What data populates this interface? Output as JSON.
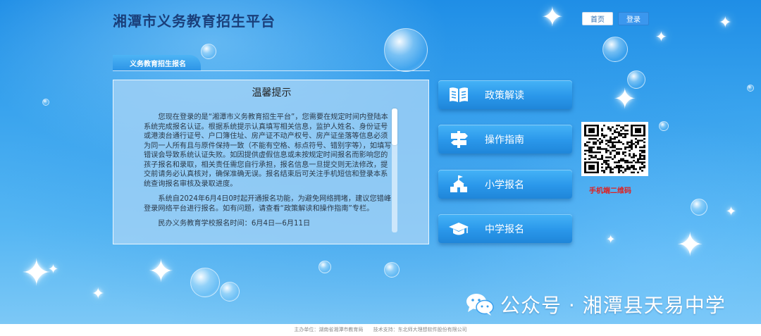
{
  "header": {
    "site_title": "湘潭市义务教育招生平台",
    "home_label": "首页",
    "login_label": "登录"
  },
  "section": {
    "tab_label": "义务教育招生报名"
  },
  "notice": {
    "title": "温馨提示",
    "paragraph_1": "您现在登录的是“湘潭市义务教育招生平台”，您需要在规定时间内登陆本系统完成报名认证。根据系统提示认真填写相关信息，监护人姓名、身份证号或港澳台通行证号、户口簿住址、房产证不动产权号、房产证坐落等信息必须为同一人所有且与原件保持一致（不能有空格、标点符号、错别字等），如填写错误会导致系统认证失败。如因提供虚假信息或未按规定时间报名而影响您的孩子报名和录取，相关责任需您自行承担，报名信息一旦提交则无法修改，提交前请务必认真核对，确保准确无误。报名结束后可关注手机短信和登录本系统查询报名审核及录取进度。",
    "paragraph_2": "系统自2024年6月4日0时起开通报名功能，为避免网络拥堵，建议您错峰登录网络平台进行报名。如有问题，请查看“政策解读和操作指南”专栏。",
    "paragraph_3": "民办义务教育学校报名时间：6月4日—6月11日"
  },
  "menu": [
    {
      "label": "政策解读",
      "icon": "book-icon"
    },
    {
      "label": "操作指南",
      "icon": "signpost-icon"
    },
    {
      "label": "小学报名",
      "icon": "school-icon"
    },
    {
      "label": "中学报名",
      "icon": "graduation-cap-icon"
    }
  ],
  "qr": {
    "caption": "手机端二维码"
  },
  "watermark": {
    "text": "公众号 · 湘潭县天易中学",
    "icon": "wechat-icon"
  },
  "footer": {
    "host": "主办单位：湖南省湘潭市教育局",
    "support": "技术支持：东北师大理想软件股份有限公司"
  },
  "colors": {
    "accent": "#2a97ea",
    "title": "#1a3f7a",
    "qr_caption": "#e02020"
  }
}
